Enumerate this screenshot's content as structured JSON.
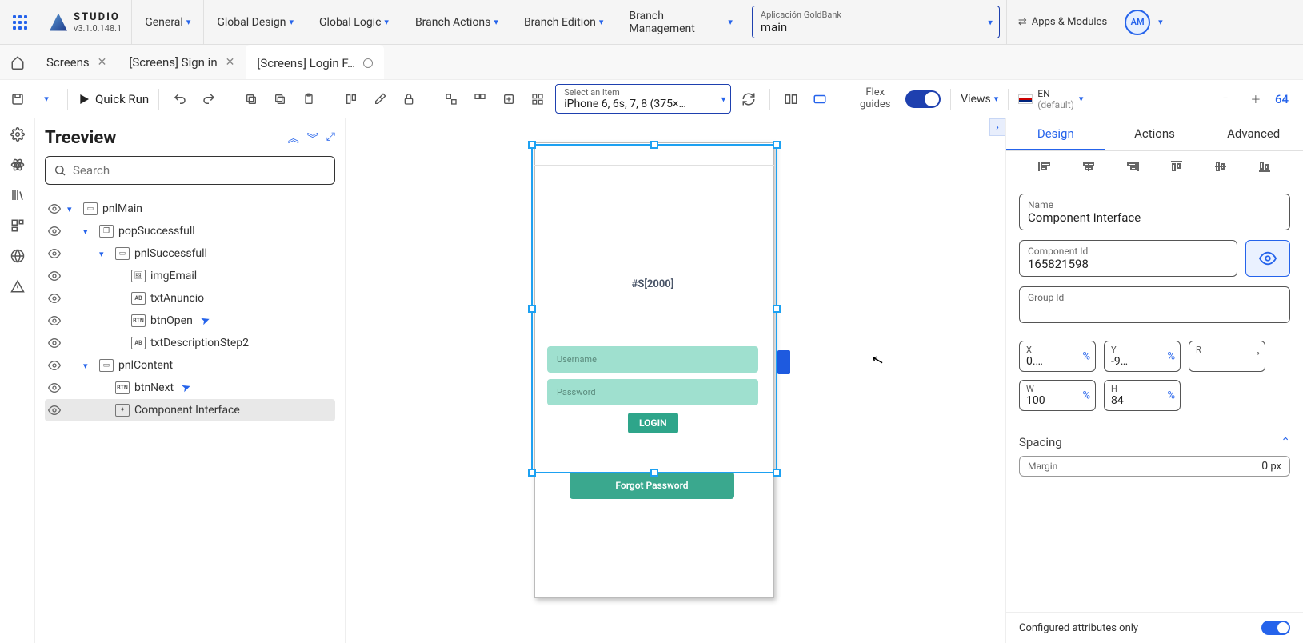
{
  "header": {
    "studio_label": "STUDIO",
    "version": "v3.1.0.148.1",
    "menus": [
      "General",
      "Global Design",
      "Global Logic",
      "Branch Actions",
      "Branch Edition",
      "Branch Management"
    ],
    "project_label": "Aplicación GoldBank",
    "project_branch": "main",
    "apps_modules": "Apps & Modules",
    "avatar": "AM"
  },
  "tabs": {
    "items": [
      {
        "label": "Screens",
        "closable": true
      },
      {
        "label": "[Screens] Sign in",
        "closable": true
      },
      {
        "label": "[Screens] Login F…",
        "dirty": true
      }
    ]
  },
  "toolbar": {
    "quick_run": "Quick Run",
    "device_label": "Select an item",
    "device_value": "iPhone 6, 6s, 7, 8 (375×…",
    "flex_guides": "Flex guides",
    "views": "Views",
    "lang_code": "EN",
    "lang_default": "(default)",
    "zoom": "64"
  },
  "tree": {
    "title": "Treeview",
    "search_placeholder": "Search",
    "items": [
      {
        "indent": 0,
        "arrow": "down",
        "type": "panel",
        "name": "pnlMain"
      },
      {
        "indent": 1,
        "arrow": "down",
        "type": "popup",
        "name": "popSuccessfull"
      },
      {
        "indent": 2,
        "arrow": "down",
        "type": "panel",
        "name": "pnlSuccessfull"
      },
      {
        "indent": 3,
        "arrow": "",
        "type": "img",
        "name": "imgEmail"
      },
      {
        "indent": 3,
        "arrow": "",
        "type": "text",
        "name": "txtAnuncio"
      },
      {
        "indent": 3,
        "arrow": "",
        "type": "btn",
        "name": "btnOpen",
        "action": true
      },
      {
        "indent": 3,
        "arrow": "",
        "type": "text",
        "name": "txtDescriptionStep2"
      },
      {
        "indent": 1,
        "arrow": "down",
        "type": "panel",
        "name": "pnlContent"
      },
      {
        "indent": 2,
        "arrow": "",
        "type": "btn",
        "name": "btnNext",
        "action": true
      },
      {
        "indent": 2,
        "arrow": "",
        "type": "comp",
        "name": "Component Interface",
        "selected": true
      }
    ]
  },
  "canvas": {
    "title_placeholder": "#S[2000]",
    "username_ph": "Username",
    "password_ph": "Password",
    "login_btn": "LOGIN",
    "forgot_btn": "Forgot Password"
  },
  "props": {
    "tabs": [
      "Design",
      "Actions",
      "Advanced"
    ],
    "name_label": "Name",
    "name_value": "Component Interface",
    "compid_label": "Component Id",
    "compid_value": "165821598",
    "groupid_label": "Group Id",
    "pos": {
      "x_label": "X",
      "x_value": "0.…",
      "x_unit": "%",
      "y_label": "Y",
      "y_value": "-9…",
      "y_unit": "%",
      "r_label": "R",
      "r_unit": "°",
      "w_label": "W",
      "w_value": "100",
      "w_unit": "%",
      "h_label": "H",
      "h_value": "84",
      "h_unit": "%"
    },
    "spacing_label": "Spacing",
    "margin_label": "Margin",
    "margin_value": "0",
    "margin_unit": "px",
    "config_only": "Configured attributes only"
  }
}
